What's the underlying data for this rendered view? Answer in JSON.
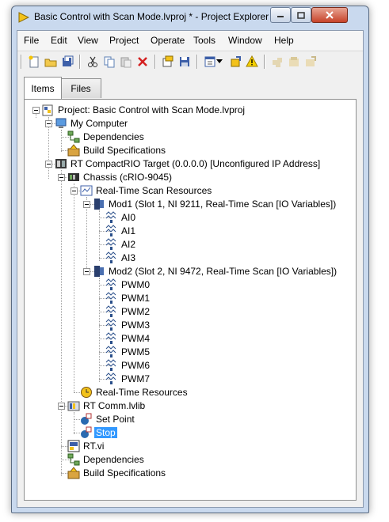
{
  "window": {
    "title": "Basic Control with Scan Mode.lvproj * - Project Explorer"
  },
  "menu": [
    "File",
    "Edit",
    "View",
    "Project",
    "Operate",
    "Tools",
    "Window",
    "Help"
  ],
  "tabs": {
    "items": "Items",
    "files": "Files"
  },
  "tree": {
    "project": "Project: Basic Control with Scan Mode.lvproj",
    "my_computer": "My Computer",
    "mc_dependencies": "Dependencies",
    "mc_build": "Build Specifications",
    "rt_target": "RT CompactRIO Target (0.0.0.0) [Unconfigured IP Address]",
    "chassis": "Chassis (cRIO-9045)",
    "scan_resources": "Real-Time Scan Resources",
    "mod1": "Mod1 (Slot 1, NI 9211, Real-Time Scan [IO Variables])",
    "ai": [
      "AI0",
      "AI1",
      "AI2",
      "AI3"
    ],
    "mod2": "Mod2 (Slot 2, NI 9472, Real-Time Scan [IO Variables])",
    "pwm": [
      "PWM0",
      "PWM1",
      "PWM2",
      "PWM3",
      "PWM4",
      "PWM5",
      "PWM6",
      "PWM7"
    ],
    "rt_resources": "Real-Time Resources",
    "rt_comm": "RT Comm.lvlib",
    "set_point": "Set Point",
    "stop": "Stop",
    "rt_vi": "RT.vi",
    "rt_dependencies": "Dependencies",
    "rt_build": "Build Specifications"
  },
  "colors": {
    "selection": "#3399ff",
    "window_frame": "#c9d9ee",
    "close_button": "#c7432a"
  }
}
